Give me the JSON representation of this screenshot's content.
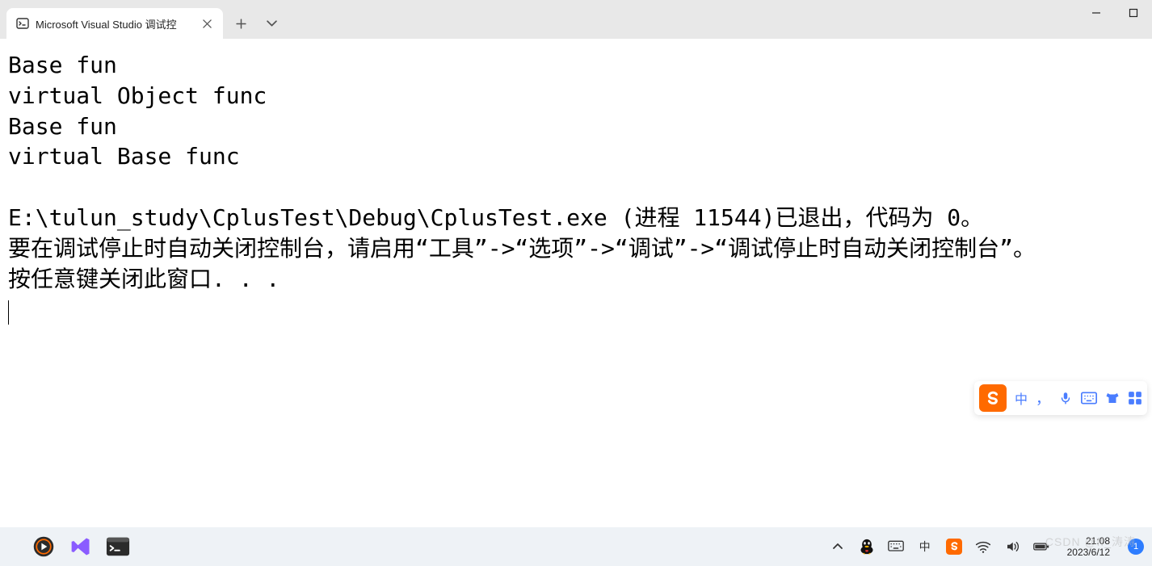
{
  "tab": {
    "title": "Microsoft Visual Studio 调试控"
  },
  "console": {
    "lines": [
      "Base fun",
      "virtual Object func",
      "Base fun",
      "virtual Base func",
      "",
      "E:\\tulun_study\\CplusTest\\Debug\\CplusTest.exe (进程 11544)已退出，代码为 0。",
      "要在调试停止时自动关闭控制台，请启用“工具”->“选项”->“调试”->“调试停止时自动关闭控制台”。",
      "按任意键关闭此窗口. . ."
    ]
  },
  "ime": {
    "lang": "中",
    "punct": "，"
  },
  "tray": {
    "time": "21:08",
    "date": "2023/6/12",
    "notif_count": "1",
    "ime_short": "中"
  },
  "watermark": "CSDN @ff_涛涛"
}
